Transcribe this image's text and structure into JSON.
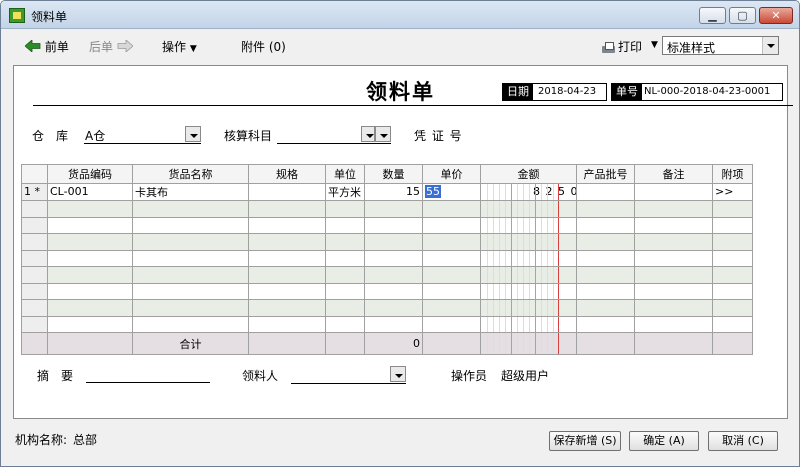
{
  "window": {
    "title": "领料单",
    "min_label": "▁",
    "max_label": "▢",
    "close_label": "✕"
  },
  "toolbar": {
    "prev_label": "前单",
    "next_label": "后单",
    "actions_label": "操作",
    "attachments_label": "附件 (0)",
    "print_label": "打印",
    "style_selected": "标准样式"
  },
  "doc": {
    "title": "领料单",
    "date_label": "日期",
    "date_value": "2018-04-23",
    "number_label": "单号",
    "number_value": "NL-000-2018-04-23-0001"
  },
  "header_fields": {
    "warehouse_label": "仓　库",
    "warehouse_value": "A仓",
    "account_label": "核算科目",
    "account_value": "",
    "voucher_label": "凭 证 号"
  },
  "grid": {
    "columns": [
      "货品编码",
      "货品名称",
      "规格",
      "单位",
      "数量",
      "单价",
      "金额",
      "产品批号",
      "备注",
      "附项"
    ],
    "rows": [
      {
        "row_no": "1",
        "marker": "*",
        "code": "CL-001",
        "name": "卡其布",
        "spec": "",
        "unit": "平方米",
        "qty": "15",
        "price": "55",
        "amount": "8 2 5 0 0",
        "batch": "",
        "note": "",
        "extra": ">>"
      }
    ],
    "total_label": "合计",
    "total_qty": "0"
  },
  "footer_fields": {
    "summary_label": "摘　要",
    "picker_label": "领料人",
    "operator_label": "操作员",
    "operator_value": "超级用户"
  },
  "status": {
    "org_label": "机构名称:",
    "org_value": "总部",
    "save_new_label": "保存新增 (S)",
    "ok_label": "确定 (A)",
    "cancel_label": "取消 (C)"
  }
}
